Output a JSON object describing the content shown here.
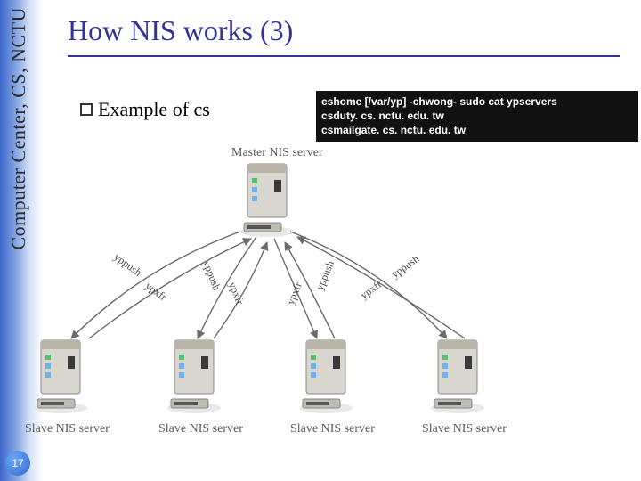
{
  "sidebar": {
    "vertical_label": "Computer Center, CS, NCTU"
  },
  "title": "How NIS works (3)",
  "bullet": {
    "text": "Example of cs"
  },
  "terminal": {
    "line1": "cshome [/var/yp] -chwong- sudo cat ypservers",
    "line2": "csduty. cs. nctu. edu. tw",
    "line3": "csmailgate. cs. nctu. edu. tw"
  },
  "diagram": {
    "master_label": "Master NIS server",
    "slave_label": "Slave NIS server",
    "push": "yppush",
    "xfr": "ypxfr"
  },
  "page_number": "17",
  "colors": {
    "accent": "#333399"
  }
}
